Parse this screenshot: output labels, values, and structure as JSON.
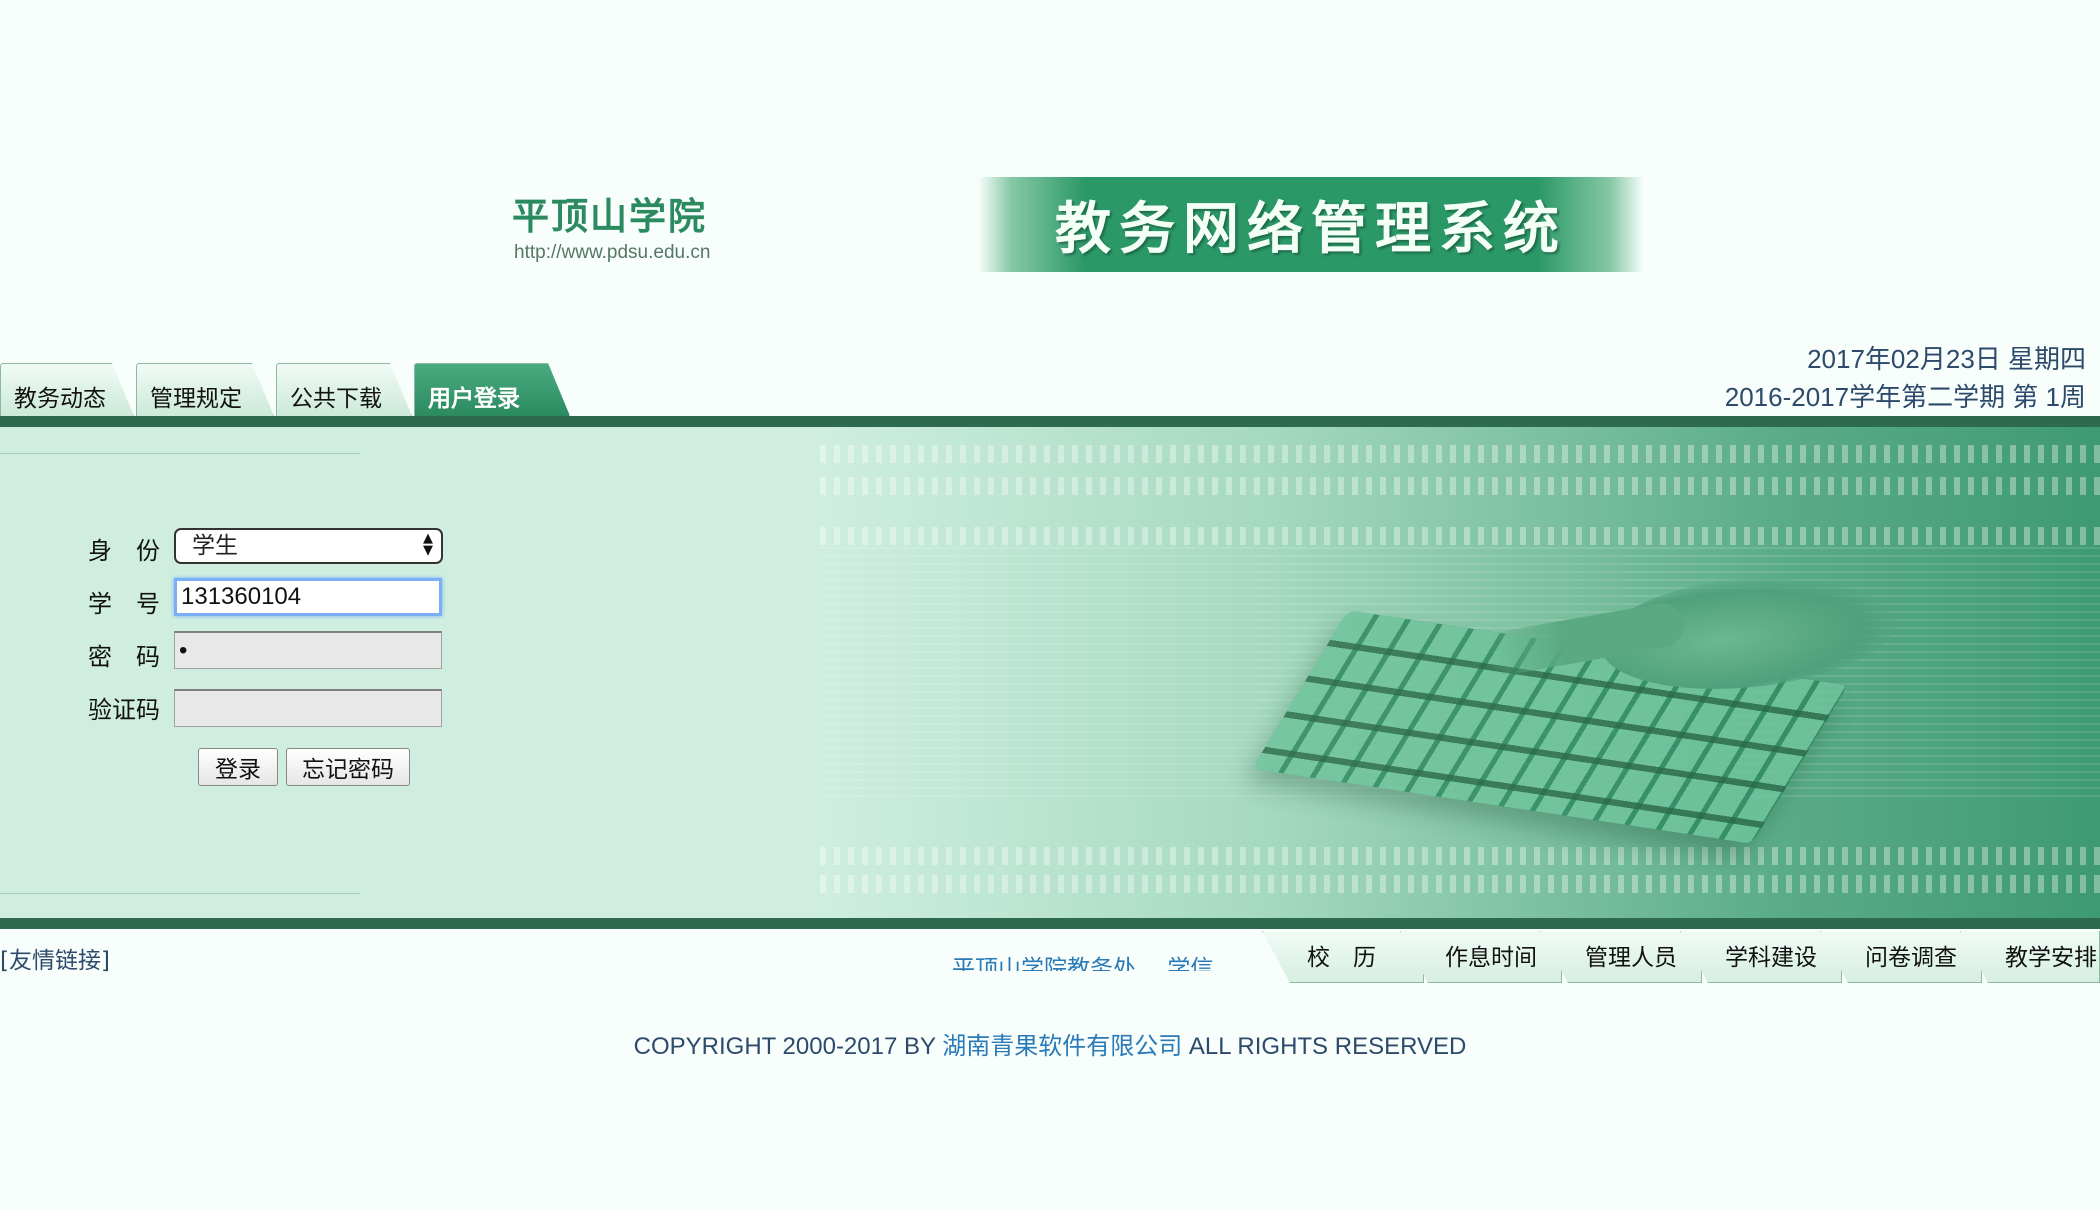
{
  "header": {
    "school_name": "平顶山学院",
    "school_url": "http://www.pdsu.edu.cn",
    "system_title": "教务网络管理系统"
  },
  "nav_tabs": [
    {
      "label": "教务动态",
      "active": false
    },
    {
      "label": "管理规定",
      "active": false
    },
    {
      "label": "公共下载",
      "active": false
    },
    {
      "label": "用户登录",
      "active": true
    }
  ],
  "date_info": {
    "date": "2017年02月23日  星期四",
    "term": "2016-2017学年第二学期  第 1周"
  },
  "login_form": {
    "identity_label": "身份",
    "identity_value": "学生",
    "student_id_label": "学号",
    "student_id_value": "131360104",
    "password_label": "密码",
    "password_value": "•",
    "captcha_label": "验证码",
    "captcha_value": "",
    "login_button": "登录",
    "forgot_button": "忘记密码"
  },
  "footer": {
    "friend_link": "[友情链接]",
    "marquee_items": [
      "平顶山学院教务处",
      "学信网"
    ],
    "bottom_tabs": [
      "校　历",
      "作息时间",
      "管理人员",
      "学科建设",
      "问卷调查",
      "教学安排"
    ],
    "copyright_prefix": "COPYRIGHT 2000-2017 BY ",
    "copyright_company": "湖南青果软件有限公司",
    "copyright_suffix": " ALL RIGHTS RESERVED"
  },
  "colors": {
    "accent_green": "#2b8a60",
    "dark_bar": "#2e6a50",
    "panel_bg": "#cfeee0",
    "link_blue": "#2a7ab8",
    "text_navy": "#2d4a6a",
    "focus_blue": "#7aaef6"
  }
}
